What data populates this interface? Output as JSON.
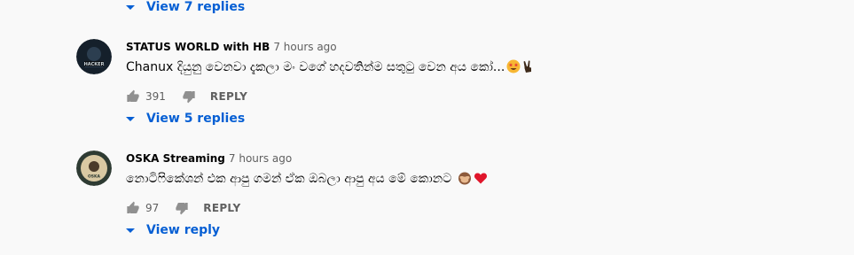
{
  "top_replies": {
    "label": "View 7 replies"
  },
  "comments": [
    {
      "author": "STATUS WORLD with HB",
      "time": "7 hours ago",
      "text": "Chanux දියුනු වෙනවා දැකලා මං වගේ හදවතින්ම සතුටු වෙන අය කෝ...",
      "likes": "391",
      "reply_label": "REPLY",
      "replies_label": "View 5 replies",
      "avatar_text": "HACKER"
    },
    {
      "author": "OSKA Streaming",
      "time": "7 hours ago",
      "text": "නොටිෆිකේශන් එක ආපු ගමන් ඒක ඔබලා ආපු අය මේ කොනට",
      "likes": "97",
      "reply_label": "REPLY",
      "replies_label": "View reply",
      "avatar_text": "OSKA"
    }
  ],
  "colors": {
    "link_blue": "#065fd4",
    "secondary_text": "#606060",
    "background": "#f9f9f9"
  },
  "icons": [
    "caret-down-icon",
    "thumbs-up-icon",
    "thumbs-down-icon",
    "star-struck-emoji",
    "victory-hand-emoji",
    "see-no-evil-monkey-emoji",
    "red-heart-emoji"
  ]
}
